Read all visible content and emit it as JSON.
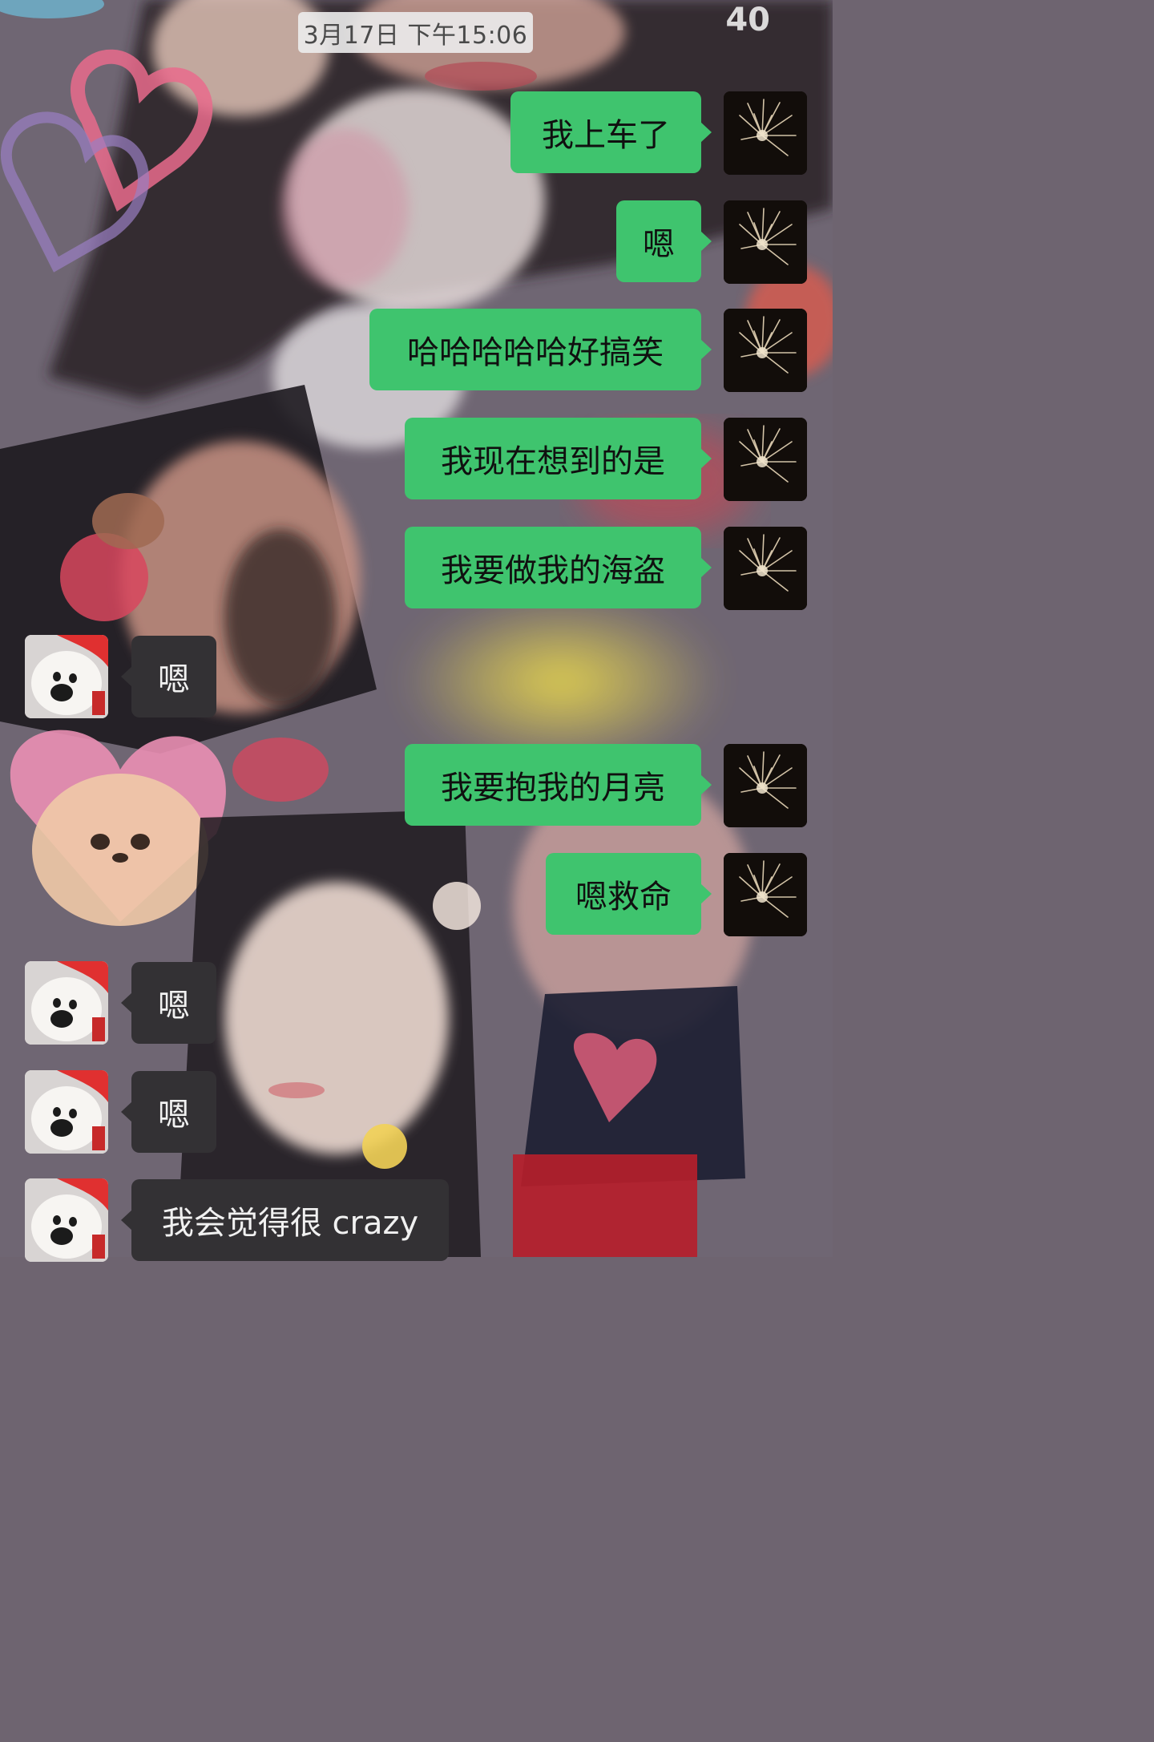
{
  "status_bar": {
    "corner_number": "40"
  },
  "timestamp": "3月17日 下午15:06",
  "messages": [
    {
      "side": "out",
      "text": "我上车了",
      "avatar": "fireworks-avatar"
    },
    {
      "side": "out",
      "text": "嗯",
      "avatar": "fireworks-avatar"
    },
    {
      "side": "out",
      "text": "哈哈哈哈哈好搞笑",
      "avatar": "fireworks-avatar"
    },
    {
      "side": "out",
      "text": "我现在想到的是",
      "avatar": "fireworks-avatar"
    },
    {
      "side": "out",
      "text": "我要做我的海盗",
      "avatar": "fireworks-avatar"
    },
    {
      "side": "in",
      "text": "嗯",
      "avatar": "puppy-santa-hat-avatar"
    },
    {
      "side": "out",
      "text": "我要抱我的月亮",
      "avatar": "fireworks-avatar"
    },
    {
      "side": "out",
      "text": "嗯救命",
      "avatar": "fireworks-avatar"
    },
    {
      "side": "in",
      "text": "嗯",
      "avatar": "puppy-santa-hat-avatar"
    },
    {
      "side": "in",
      "text": "嗯",
      "avatar": "puppy-santa-hat-avatar"
    },
    {
      "side": "in",
      "text": "我会觉得很 crazy",
      "avatar": "puppy-santa-hat-avatar"
    }
  ],
  "colors": {
    "outgoing_bubble": "#3fc46e",
    "incoming_bubble": "#333134",
    "background": "#6e6470"
  }
}
